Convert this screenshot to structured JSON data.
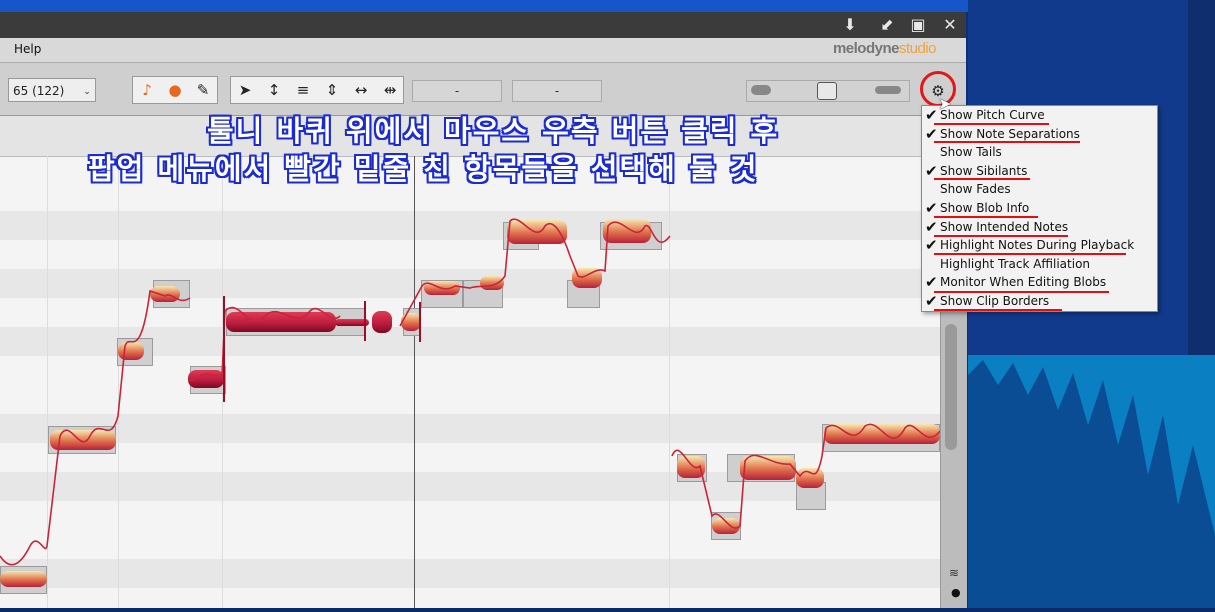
{
  "menubar": {
    "help_label": "Help"
  },
  "logo": {
    "brand": "melodyne",
    "edition": "studio"
  },
  "toolbar": {
    "position_value": "65 (122)",
    "pitch_field": "-",
    "timing_field": "-"
  },
  "annotation": {
    "line1": "툴니 바퀴 위에서 마우스 우측 버튼 클릭 후",
    "line2": "팝업 메뉴에서 빨간 밑줄 친 항목들을 선택해 둘 것"
  },
  "popup_menu": {
    "items": [
      {
        "label": "Show Pitch Curve",
        "checked": true,
        "underlined": true
      },
      {
        "label": "Show Note Separations",
        "checked": true,
        "underlined": true
      },
      {
        "label": "Show Tails",
        "checked": false,
        "underlined": false
      },
      {
        "label": "Show Sibilants",
        "checked": true,
        "underlined": true
      },
      {
        "label": "Show Fades",
        "checked": false,
        "underlined": false
      },
      {
        "label": "Show Blob Info",
        "checked": true,
        "underlined": true
      },
      {
        "label": "Show Intended Notes",
        "checked": true,
        "underlined": true
      },
      {
        "label": "Highlight Notes During Playback",
        "checked": true,
        "underlined": true
      },
      {
        "label": "Highlight Track Affiliation",
        "checked": false,
        "underlined": false
      },
      {
        "label": "Monitor When Editing Blobs",
        "checked": true,
        "underlined": true
      },
      {
        "label": "Show Clip Borders",
        "checked": true,
        "underlined": true
      }
    ]
  },
  "colors": {
    "highlight_circle": "#e01818",
    "underline": "#e01010",
    "text_outline": "#1b2bd1"
  },
  "icons": {
    "window": [
      "pin-icon",
      "undock-icon",
      "maximize-icon",
      "close-icon"
    ],
    "gear": "gear-icon"
  }
}
